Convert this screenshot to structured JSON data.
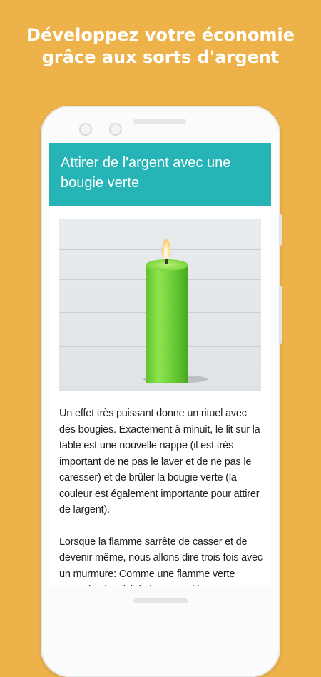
{
  "promo": {
    "headline_line1": "Développez votre économie",
    "headline_line2": "grâce aux sorts d'argent"
  },
  "article": {
    "title": "Attirer de l'argent avec une bougie verte",
    "image_label": "green-candle-photo",
    "paragraph1": "Un effet très puissant donne un rituel avec des bougies. Exactement à minuit, le lit sur la table est une nouvelle nappe (il est très important de ne pas le laver et de ne pas le caresser) et de brûler la bougie verte (la couleur est également importante pour attirer de largent).",
    "paragraph2": "Lorsque la flamme sarrête de casser et de devenir même, nous allons dire trois fois avec un murmure: Comme une flamme verte s'ennuit, alors ici de largent. Si la"
  },
  "colors": {
    "background": "#EDB24A",
    "appbar": "#26B4B7",
    "candle": "#6fd03a"
  }
}
